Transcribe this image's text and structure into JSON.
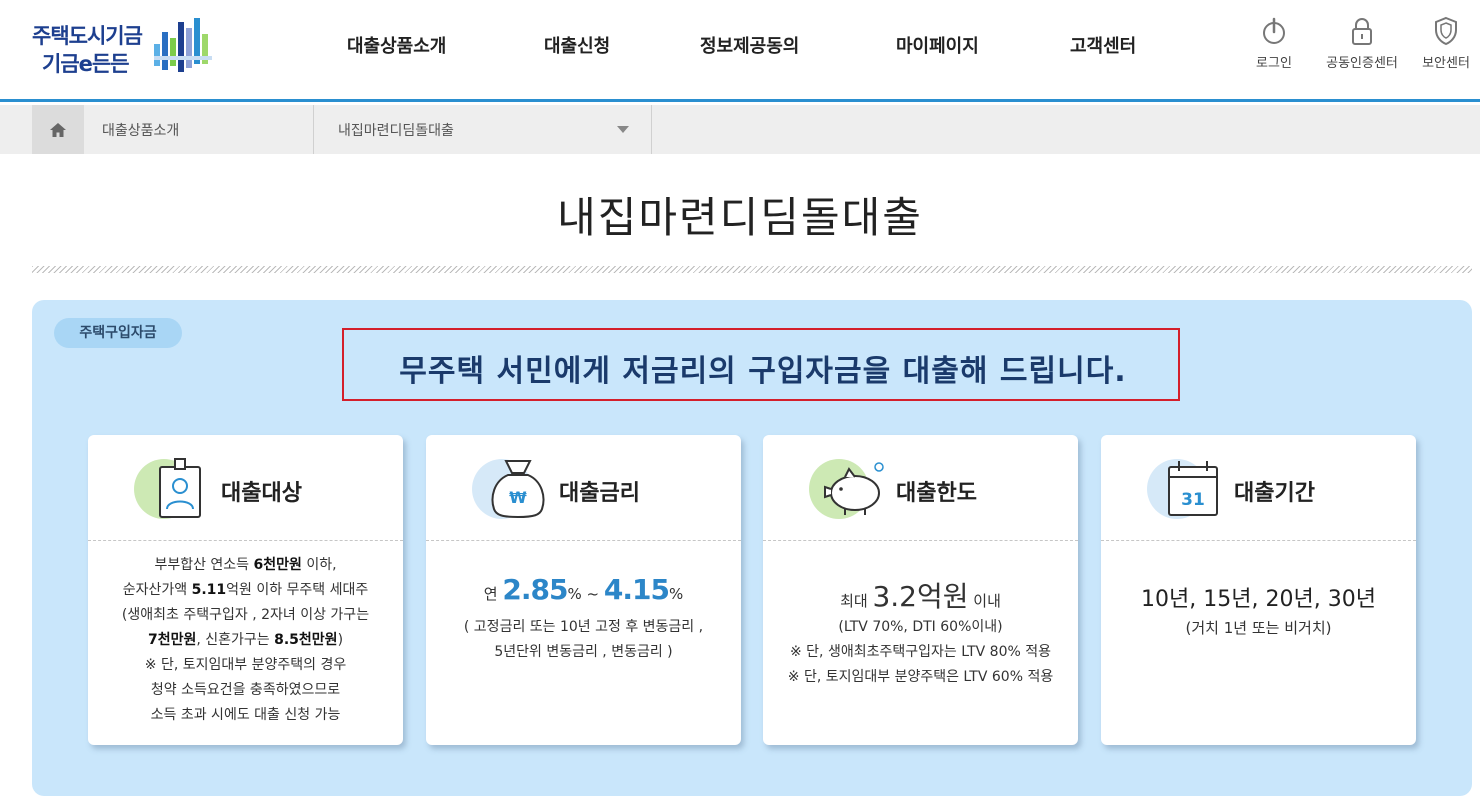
{
  "logo": {
    "line1": "주택도시기금",
    "line2": "기금e든든"
  },
  "gnb": [
    {
      "label": "대출상품소개"
    },
    {
      "label": "대출신청"
    },
    {
      "label": "정보제공동의"
    },
    {
      "label": "마이페이지"
    },
    {
      "label": "고객센터"
    }
  ],
  "util": [
    {
      "label": "로그인",
      "icon": "power-icon"
    },
    {
      "label": "공동인증센터",
      "icon": "lock-icon"
    },
    {
      "label": "보안센터",
      "icon": "shield-icon"
    }
  ],
  "location": {
    "level1": "대출상품소개",
    "level2": "내집마련디딤돌대출"
  },
  "page_title": "내집마련디딤돌대출",
  "panel": {
    "badge": "주택구입자금",
    "headline": "무주택 서민에게 저금리의 구입자금을 대출해 드립니다."
  },
  "cards": {
    "target": {
      "title": "대출대상",
      "l1a": "부부합산 연소득 ",
      "l1b": "6천만원",
      "l1c": " 이하,",
      "l2a": "순자산가액 ",
      "l2b": "5.11",
      "l2c": "억원 이하 무주택 세대주",
      "l3": "(생애최초 주택구입자 , 2자녀 이상 가구는",
      "l4a": "7천만원",
      "l4b": ", 신혼가구는 ",
      "l4c": "8.5천만원",
      "l4d": ")",
      "l5": "※ 단, 토지임대부 분양주택의 경우",
      "l6": "청약 소득요건을 충족하였으므로",
      "l7": "소득 초과 시에도 대출 신청 가능"
    },
    "rate": {
      "title": "대출금리",
      "prefix": "연 ",
      "min": "2.85",
      "pct1": "%",
      "tilde": " ~ ",
      "max": "4.15",
      "pct2": "%",
      "note1": "( 고정금리 또는 10년 고정 후 변동금리 ,",
      "note2": "5년단위 변동금리 , 변동금리 )"
    },
    "limit": {
      "title": "대출한도",
      "prefix": "최대 ",
      "amount": "3.2억원",
      "suffix": " 이내",
      "note1": "(LTV 70%, DTI 60%이내)",
      "note2": "※ 단, 생애최초주택구입자는 LTV 80% 적용",
      "note3": "※ 단, 토지임대부 분양주택은 LTV 60% 적용"
    },
    "term": {
      "title": "대출기간",
      "calendar_day": "31",
      "main": "10년, 15년, 20년, 30년",
      "note": "(거치 1년 또는 비거치)"
    }
  },
  "colors": {
    "accent": "#2a8fd0",
    "panel_bg": "#c9e6fb",
    "highlight_border": "#d41f2a",
    "rate_blue": "#2c86c8"
  }
}
